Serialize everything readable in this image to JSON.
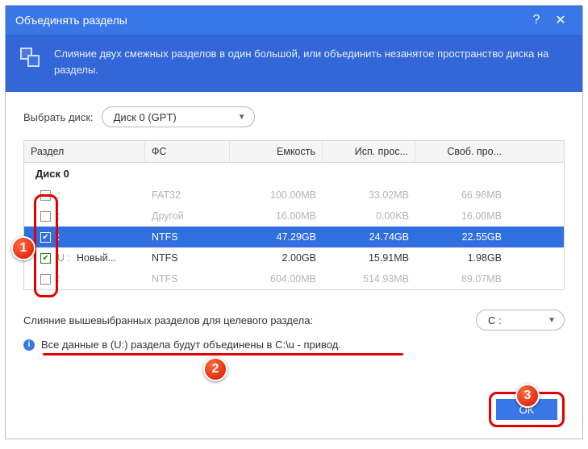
{
  "title": "Объединять разделы",
  "banner_text": "Слияние двух смежных разделов в один большой, или объединить незанятое пространство диска на разделы.",
  "select_disk_label": "Выбрать диск:",
  "select_disk_value": "Диск 0 (GPT)",
  "columns": {
    "partition": "Раздел",
    "fs": "ФС",
    "capacity": "Емкость",
    "used": "Исп. прос...",
    "free": "Своб. про..."
  },
  "group_label": "Диск 0",
  "rows": [
    {
      "checked": false,
      "letter": ":",
      "name": "",
      "fs": "FAT32",
      "cap": "100.00MB",
      "used": "33.02MB",
      "free": "66.98MB",
      "state": "disabled"
    },
    {
      "checked": false,
      "letter": ":",
      "name": "",
      "fs": "Другой",
      "cap": "16.00MB",
      "used": "0.00KB",
      "free": "16.00MB",
      "state": "disabled"
    },
    {
      "checked": true,
      "letter": ":",
      "name": "",
      "fs": "NTFS",
      "cap": "47.29GB",
      "used": "24.74GB",
      "free": "22.55GB",
      "state": "selected"
    },
    {
      "checked": true,
      "letter": "U :",
      "name": "Новый...",
      "fs": "NTFS",
      "cap": "2.00GB",
      "used": "15.91MB",
      "free": "1.98GB",
      "state": "active"
    },
    {
      "checked": false,
      "letter": ":",
      "name": "",
      "fs": "NTFS",
      "cap": "604.00MB",
      "used": "514.93MB",
      "free": "89.07MB",
      "state": "disabled"
    }
  ],
  "merge_label": "Слияние вышевыбранных разделов для целевого раздела:",
  "target_value": "C :",
  "info_text": "Все данные в (U:) раздела будут объединены в C:\\u - привод.",
  "ok_label": "OK",
  "callouts": {
    "1": "1",
    "2": "2",
    "3": "3"
  }
}
